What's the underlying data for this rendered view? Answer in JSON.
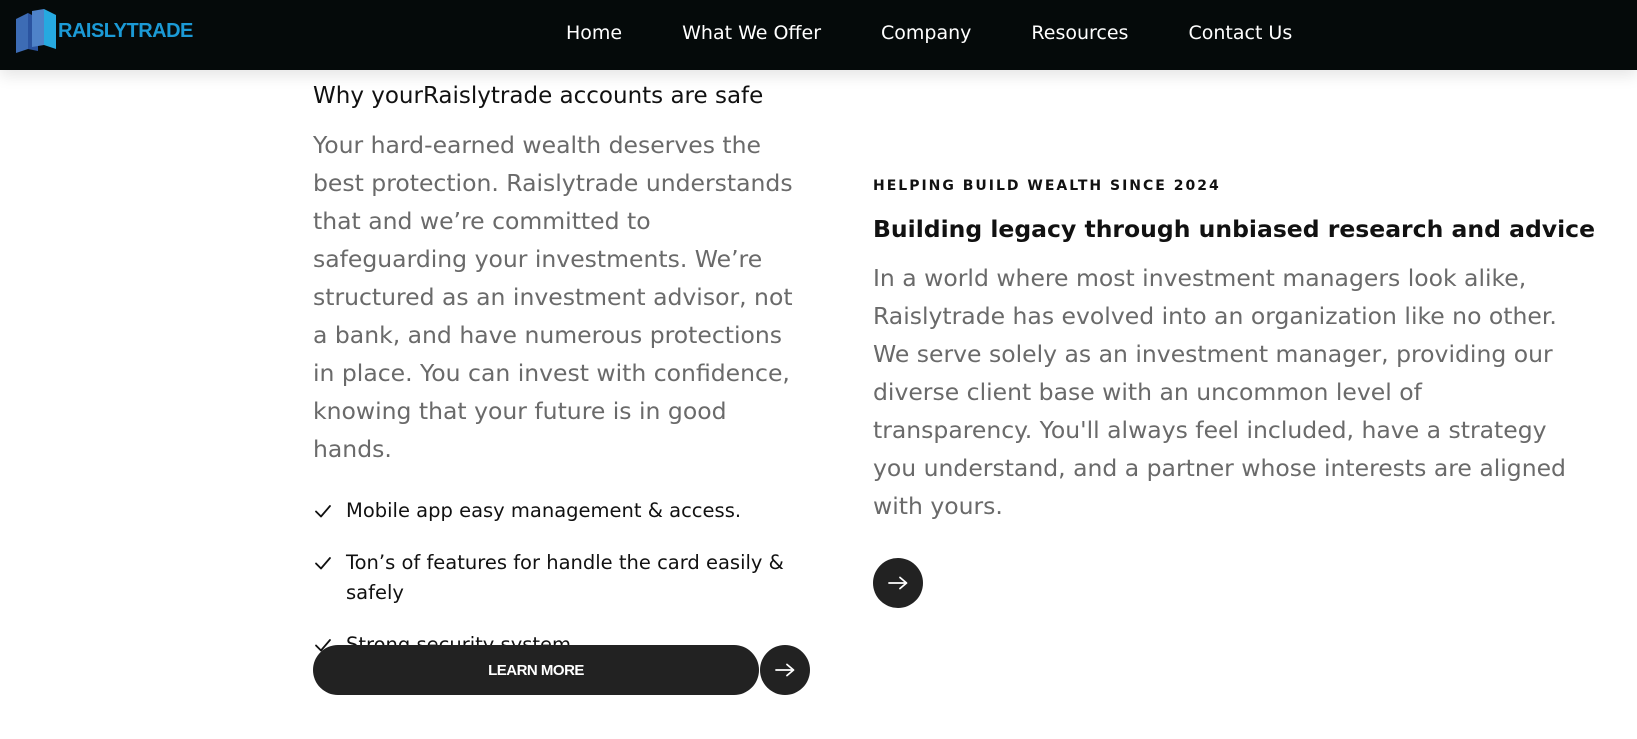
{
  "header": {
    "logo_text": "RAISLYTRADE",
    "nav": [
      "Home",
      "What We Offer",
      "Company",
      "Resources",
      "Contact Us"
    ]
  },
  "safety": {
    "title": "Why yourRaislytrade accounts are safe",
    "body": "Your hard-earned wealth deserves the best protection. Raislytrade understands that and we’re committed to safeguarding your investments. We’re structured as an investment advisor, not a bank, and have numerous protections in place. You can invest with confidence, knowing that your future is in good hands.",
    "features": [
      "Mobile app easy management & access.",
      "Ton’s of features for handle the card easily & safely",
      "Strong security system."
    ],
    "cta_label": "LEARN MORE"
  },
  "legacy": {
    "eyebrow": "HELPING BUILD WEALTH SINCE 2024",
    "title": "Building legacy through unbiased research and advice",
    "body": "In a world where most investment managers look alike, Raislytrade has evolved into an organization like no other. We serve solely as an investment manager, providing our diverse client base with an uncommon level of transparency. You'll always feel included, have a strategy you understand, and a partner whose interests are aligned with yours."
  },
  "icons": {
    "logo": "building-logo-icon",
    "check": "check-icon",
    "arrow": "arrow-right-icon"
  },
  "colors": {
    "header_bg": "#050a0a",
    "brand": "#1b9ad6",
    "button_bg": "#222222",
    "body_text": "#6a6a6a"
  }
}
